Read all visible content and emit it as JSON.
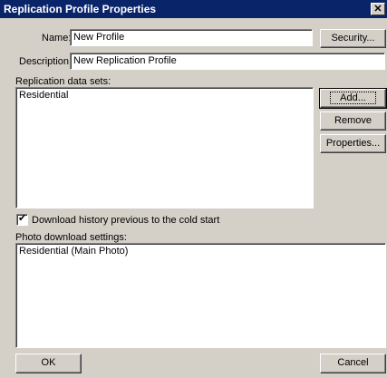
{
  "window": {
    "title": "Replication Profile Properties",
    "close_glyph": "✕"
  },
  "name": {
    "label": "Name:",
    "value": "New Profile"
  },
  "description": {
    "label": "Description:",
    "value": "New Replication Profile"
  },
  "buttons": {
    "security": "Security...",
    "add": "Add...",
    "remove": "Remove",
    "properties": "Properties...",
    "ok": "OK",
    "cancel": "Cancel"
  },
  "datasets": {
    "label": "Replication data sets:",
    "items": [
      "Residential"
    ]
  },
  "download_history": {
    "label": "Download history previous to the cold start",
    "checked": true,
    "check_glyph": "✔"
  },
  "photo": {
    "label": "Photo download settings:",
    "items": [
      "Residential (Main Photo)"
    ]
  }
}
